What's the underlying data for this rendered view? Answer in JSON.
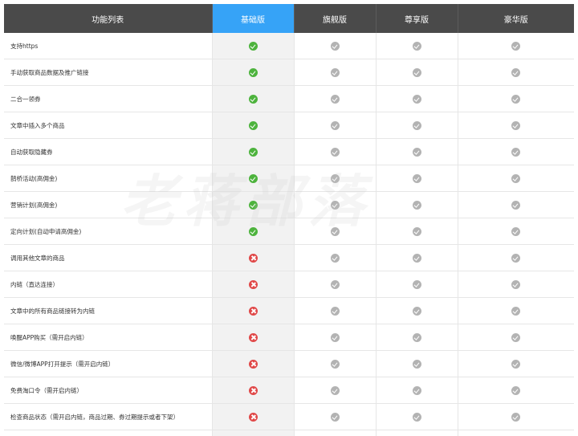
{
  "table": {
    "headers": [
      {
        "label": "功能列表",
        "highlight": false
      },
      {
        "label": "基础版",
        "highlight": true
      },
      {
        "label": "旗舰版",
        "highlight": false
      },
      {
        "label": "尊享版",
        "highlight": false
      },
      {
        "label": "豪华版",
        "highlight": false
      }
    ],
    "rows": [
      {
        "feature": "支持https",
        "values": [
          "yes",
          "yes",
          "yes",
          "yes"
        ]
      },
      {
        "feature": "手动获取商品数据及推广链接",
        "values": [
          "yes",
          "yes",
          "yes",
          "yes"
        ]
      },
      {
        "feature": "二合一领券",
        "values": [
          "yes",
          "yes",
          "yes",
          "yes"
        ]
      },
      {
        "feature": "文章中插入多个商品",
        "values": [
          "yes",
          "yes",
          "yes",
          "yes"
        ]
      },
      {
        "feature": "自动获取隐藏券",
        "values": [
          "yes",
          "yes",
          "yes",
          "yes"
        ]
      },
      {
        "feature": "鹊桥活动(高佣金)",
        "values": [
          "yes",
          "yes",
          "yes",
          "yes"
        ]
      },
      {
        "feature": "营销计划(高佣金)",
        "values": [
          "yes",
          "yes",
          "yes",
          "yes"
        ]
      },
      {
        "feature": "定向计划(自动申请高佣金)",
        "values": [
          "yes",
          "yes",
          "yes",
          "yes"
        ]
      },
      {
        "feature": "调用其他文章的商品",
        "values": [
          "no",
          "yes",
          "yes",
          "yes"
        ]
      },
      {
        "feature": "内链（直达连接）",
        "values": [
          "no",
          "yes",
          "yes",
          "yes"
        ]
      },
      {
        "feature": "文章中的所有商品链接转为内链",
        "values": [
          "no",
          "yes",
          "yes",
          "yes"
        ]
      },
      {
        "feature": "唤醒APP购买（需开启内链）",
        "values": [
          "no",
          "yes",
          "yes",
          "yes"
        ]
      },
      {
        "feature": "微信/微博APP打开提示（需开启内链）",
        "values": [
          "no",
          "yes",
          "yes",
          "yes"
        ]
      },
      {
        "feature": "免费淘口令（需开启内链）",
        "values": [
          "no",
          "yes",
          "yes",
          "yes"
        ]
      },
      {
        "feature": "检查商品状态（需开启内链，商品过期、券过期提示或者下架）",
        "values": [
          "no",
          "yes",
          "yes",
          "yes"
        ]
      },
      {
        "feature": "",
        "values": [
          "",
          "",
          "",
          ""
        ]
      }
    ]
  },
  "icons": {
    "yes_highlight": "check-circle-green-icon",
    "yes": "check-circle-gray-icon",
    "no": "cross-circle-red-icon"
  },
  "colors": {
    "header_bg": "#4a4a4a",
    "header_highlight": "#36a3f7",
    "check_green": "#4db33d",
    "check_gray": "#b3b3b3",
    "cross_red": "#e04848",
    "highlight_column_bg": "#f2f2f2"
  },
  "watermark": "老蒋部落"
}
